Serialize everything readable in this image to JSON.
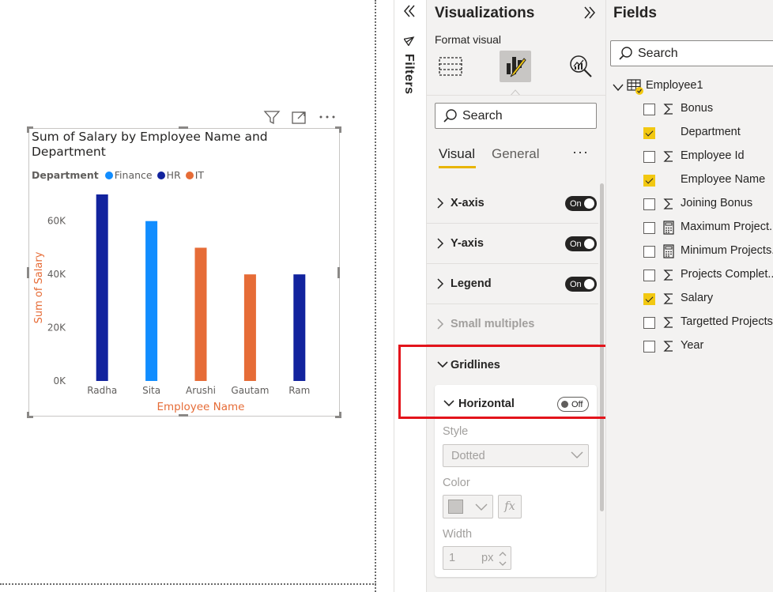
{
  "report": {
    "visual_header": {
      "filter_icon": "filter-icon",
      "focus_icon": "focus-mode-icon",
      "more_icon": "more-options-icon"
    }
  },
  "chart_data": {
    "type": "bar",
    "title": "Sum of Salary by Employee Name and Department",
    "title_line1": "Sum of Salary by Employee Name and",
    "title_line2": "Department",
    "legend_title": "Department",
    "legend": [
      {
        "name": "Finance",
        "color": "#118dff"
      },
      {
        "name": "HR",
        "color": "#12239e"
      },
      {
        "name": "IT",
        "color": "#e66c37"
      }
    ],
    "xlabel": "Employee Name",
    "ylabel": "Sum of Salary",
    "ylim": [
      0,
      70000
    ],
    "yticks": [
      {
        "value": 0,
        "label": "0K"
      },
      {
        "value": 20000,
        "label": "20K"
      },
      {
        "value": 40000,
        "label": "40K"
      },
      {
        "value": 60000,
        "label": "60K"
      }
    ],
    "categories": [
      "Radha",
      "Sita",
      "Arushi",
      "Gautam",
      "Ram"
    ],
    "series": [
      {
        "name": "Finance",
        "color": "#118dff",
        "values": [
          null,
          60000,
          null,
          null,
          null
        ]
      },
      {
        "name": "HR",
        "color": "#12239e",
        "values": [
          70000,
          null,
          null,
          null,
          40000
        ]
      },
      {
        "name": "IT",
        "color": "#e66c37",
        "values": [
          null,
          null,
          50000,
          40000,
          null
        ]
      }
    ],
    "gridlines": false
  },
  "filters": {
    "label": "Filters",
    "collapse_icon": "double-chevron-left-icon"
  },
  "visualizations": {
    "title": "Visualizations",
    "expand_icon": "double-chevron-right-icon",
    "format_label": "Format visual",
    "search_placeholder": "Search",
    "tabs": {
      "visual": "Visual",
      "general": "General",
      "more": "···"
    },
    "cards": [
      {
        "label": "X-axis",
        "toggle": "On"
      },
      {
        "label": "Y-axis",
        "toggle": "On"
      },
      {
        "label": "Legend",
        "toggle": "On"
      },
      {
        "label": "Small multiples"
      },
      {
        "label": "Gridlines"
      }
    ],
    "horizontal": {
      "label": "Horizontal",
      "toggle": "Off",
      "style_label": "Style",
      "style_value": "Dotted",
      "color_label": "Color",
      "color_swatch": "#c8c6c4",
      "fx": "fx",
      "width_label": "Width",
      "width_value": "1",
      "width_unit": "px"
    }
  },
  "fields": {
    "title": "Fields",
    "search_placeholder": "Search",
    "table": "Employee1",
    "items": [
      {
        "name": "Bonus",
        "icon": "sigma-icon",
        "checked": false
      },
      {
        "name": "Department",
        "icon": "none",
        "checked": true
      },
      {
        "name": "Employee Id",
        "icon": "sigma-icon",
        "checked": false
      },
      {
        "name": "Employee Name",
        "icon": "none",
        "checked": true
      },
      {
        "name": "Joining Bonus",
        "icon": "sigma-icon",
        "checked": false
      },
      {
        "name": "Maximum Project...",
        "icon": "calculator-icon",
        "checked": false
      },
      {
        "name": "Minimum Projects...",
        "icon": "calculator-icon",
        "checked": false
      },
      {
        "name": "Projects Complet...",
        "icon": "sigma-icon",
        "checked": false
      },
      {
        "name": "Salary",
        "icon": "sigma-icon",
        "checked": true
      },
      {
        "name": "Targetted Projects",
        "icon": "sigma-icon",
        "checked": false
      },
      {
        "name": "Year",
        "icon": "sigma-icon",
        "checked": false
      }
    ]
  }
}
